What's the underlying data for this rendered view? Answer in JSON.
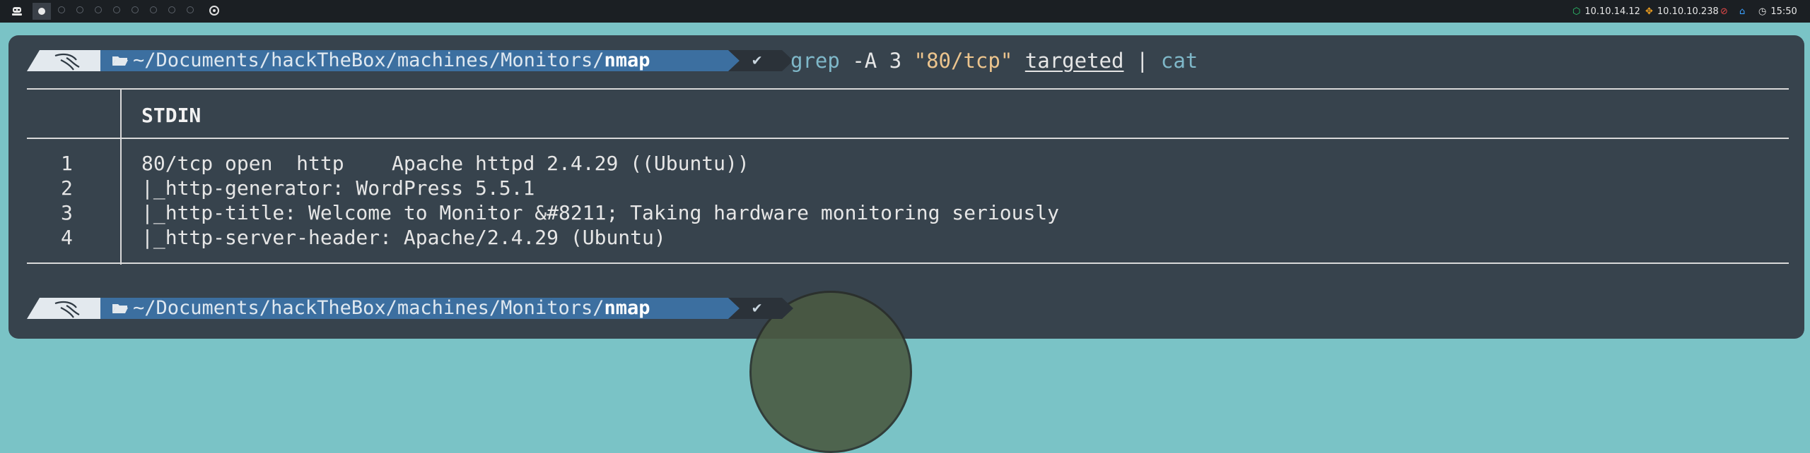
{
  "topbar": {
    "menu_icon": "kali-menu-icon",
    "workspaces": [
      "active",
      "empty",
      "empty",
      "empty",
      "empty",
      "empty",
      "empty",
      "empty",
      "empty"
    ],
    "target_icon": "target-icon",
    "ip_vpn": "10.10.14.12",
    "ip_target": "10.10.10.238",
    "clock": "15:50",
    "colors": {
      "vpn": "#2ecc71",
      "target": "#f0a020",
      "disconnect": "#e04848",
      "home": "#3aa0ff"
    }
  },
  "prompt1": {
    "path_prefix": "~/Documents/hackTheBox/machines/Monitors/",
    "path_dir": "nmap",
    "check": "✔",
    "cmd": {
      "grep": "grep",
      "flag": "-A 3",
      "pattern": "\"80/tcp\"",
      "file": "targeted",
      "pipe": "|",
      "cat": "cat"
    }
  },
  "output": {
    "header": "STDIN",
    "line_numbers": [
      "1",
      "2",
      "3",
      "4"
    ],
    "lines": [
      "80/tcp open  http    Apache httpd 2.4.29 ((Ubuntu))",
      "|_http-generator: WordPress 5.5.1",
      "|_http-title: Welcome to Monitor &#8211; Taking hardware monitoring seriously",
      "|_http-server-header: Apache/2.4.29 (Ubuntu)"
    ]
  },
  "prompt2": {
    "path_prefix": "~/Documents/hackTheBox/machines/Monitors/",
    "path_dir": "nmap",
    "check": "✔"
  }
}
